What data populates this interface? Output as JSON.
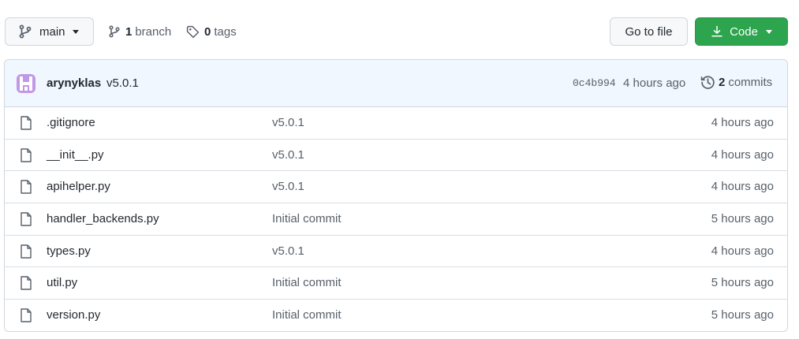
{
  "toolbar": {
    "branch_name": "main",
    "branch_count": "1",
    "branch_label": "branch",
    "tag_count": "0",
    "tag_label": "tags",
    "go_to_file_label": "Go to file",
    "code_label": "Code"
  },
  "commit": {
    "author": "arynyklas",
    "message": "v5.0.1",
    "sha": "0c4b994",
    "time": "4 hours ago",
    "commits_count": "2",
    "commits_label": "commits"
  },
  "files": [
    {
      "name": ".gitignore",
      "message": "v5.0.1",
      "time": "4 hours ago"
    },
    {
      "name": "__init__.py",
      "message": "v5.0.1",
      "time": "4 hours ago"
    },
    {
      "name": "apihelper.py",
      "message": "v5.0.1",
      "time": "4 hours ago"
    },
    {
      "name": "handler_backends.py",
      "message": "Initial commit",
      "time": "5 hours ago"
    },
    {
      "name": "types.py",
      "message": "v5.0.1",
      "time": "4 hours ago"
    },
    {
      "name": "util.py",
      "message": "Initial commit",
      "time": "5 hours ago"
    },
    {
      "name": "version.py",
      "message": "Initial commit",
      "time": "5 hours ago"
    }
  ],
  "colors": {
    "accent_green": "#2da44e",
    "header_bg": "#f0f7fe",
    "avatar_purple": "#c297e6",
    "muted_text": "#57606a",
    "border": "#d0d7de"
  },
  "icons": {
    "branch": "git-branch-icon",
    "tag": "tag-icon",
    "download": "download-icon",
    "history": "history-icon",
    "file": "file-icon"
  }
}
